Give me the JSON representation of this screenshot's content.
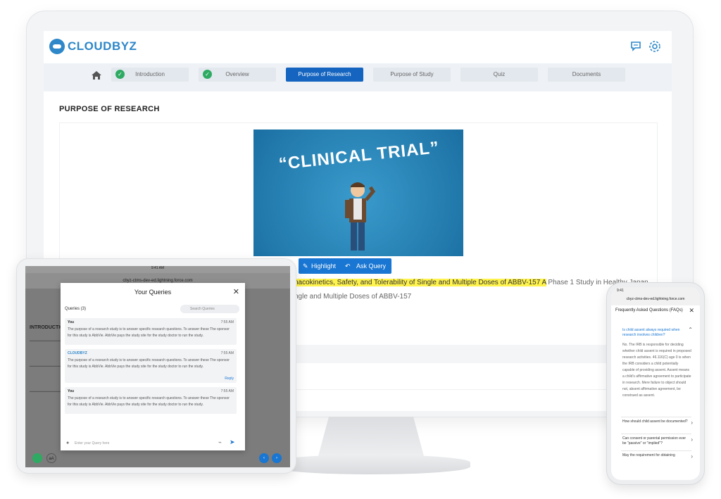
{
  "monitor": {
    "brand": "CLOUDBYZ",
    "tabs": [
      {
        "label": "Introduction",
        "completed": true,
        "active": false
      },
      {
        "label": "Overview",
        "completed": true,
        "active": false
      },
      {
        "label": "Purpose of Research",
        "completed": false,
        "active": true
      },
      {
        "label": "Purpose of Study",
        "completed": false,
        "active": false
      },
      {
        "label": "Quiz",
        "completed": false,
        "active": false
      },
      {
        "label": "Documents",
        "completed": false,
        "active": false
      }
    ],
    "page_title": "PURPOSE OF RESEARCH",
    "video_title": "“CLINICAL TRIAL”",
    "toolbar": {
      "highlight_label": "Highlight",
      "ask_query_label": "Ask Query"
    },
    "highlighted_text": "nacokinetics, Safety, and Tolerability of Single and Multiple Doses of ABBV-157 A",
    "text_after_highlight": " Phase 1 Study in Healthy Japan",
    "second_line": "ngle and Multiple Doses of ABBV-157"
  },
  "ipad": {
    "status_time": "9:41 AM",
    "url": "cbyz-ctms-dev-ed.lightning.force.com",
    "section_heading": "INTRODUCTIO",
    "modal": {
      "title": "Your Queries",
      "count_label": "Queries (3)",
      "search_placeholder": "Search Queries",
      "queries": [
        {
          "author": "You",
          "time": "7:55 AM",
          "text": "The purpose of a research study is to answer specific research questions. To answer these The sponsor for this study is AbbVie. AbbVie pays the study site for the study doctor to run the study.",
          "reply": ""
        },
        {
          "author": "CLOUDBYZ",
          "time": "7:55 AM",
          "text": "The purpose of a research study is to answer specific research questions. To answer these The sponsor for this study is AbbVie. AbbVie pays the study site for the study doctor to run the study.",
          "reply": "Reply"
        },
        {
          "author": "You",
          "time": "7:55 AM",
          "text": "The purpose of a research study is to answer specific research questions. To answer these The sponsor for this study is AbbVie. AbbVie pays the study site for the study doctor to run the study.",
          "reply": ""
        }
      ],
      "input_placeholder": "Enter your Query here"
    }
  },
  "phone": {
    "status_time": "9:41",
    "url": "cbyz-ctms-dev-ed.lightning.force.com",
    "title": "Frequently Asked Questions (FAQs)",
    "faqs": [
      {
        "question": "Is child assent always required when research involves children?",
        "answer": "No. The IRB is responsible for deciding whether child assent is required in proposed research activities. 46.116(C) age 0 is when the IRB considers a child potentially capable of providing assent. Assent means a child's affirmative agreement to participate in research. Mere failure to object should not, absent affirmative agreement, be construed as assent.",
        "expanded": true
      },
      {
        "question": "How should child assent be documented?",
        "answer": "",
        "expanded": false
      },
      {
        "question": "Can consent or parental permission ever be \"passive\" or \"implied\"?",
        "answer": "",
        "expanded": false
      },
      {
        "question": "May the requirement for obtaining",
        "answer": "",
        "expanded": false
      }
    ]
  },
  "colors": {
    "brand_blue": "#2d87c9",
    "active_tab": "#1565c0",
    "check_green": "#2eaa63",
    "highlight_yellow": "#fff34d"
  }
}
